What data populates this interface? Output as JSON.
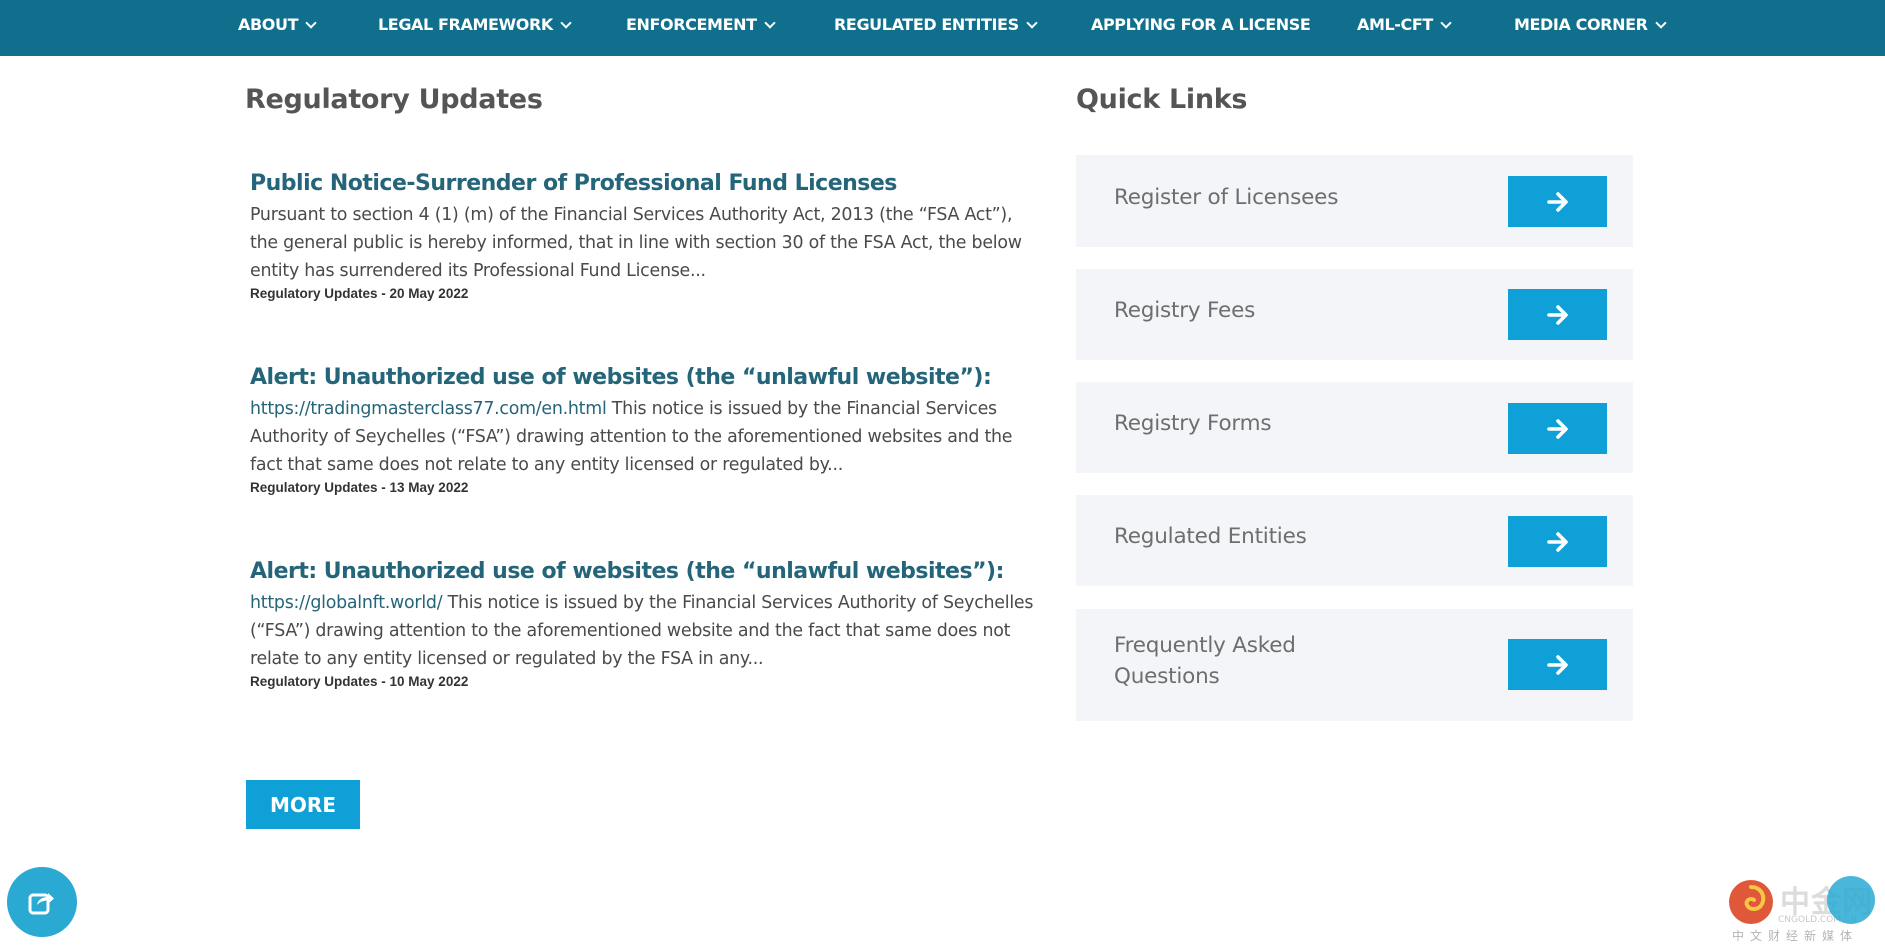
{
  "nav": {
    "items": [
      {
        "label": "ABOUT",
        "has_dropdown": true
      },
      {
        "label": "LEGAL FRAMEWORK",
        "has_dropdown": true
      },
      {
        "label": "ENFORCEMENT",
        "has_dropdown": true
      },
      {
        "label": "REGULATED ENTITIES",
        "has_dropdown": true
      },
      {
        "label": "APPLYING FOR A LICENSE",
        "has_dropdown": false
      },
      {
        "label": "AML-CFT",
        "has_dropdown": true
      },
      {
        "label": "MEDIA CORNER",
        "has_dropdown": true
      }
    ]
  },
  "updates": {
    "title": "Regulatory Updates",
    "items": [
      {
        "title": "Public Notice-Surrender of Professional Fund Licenses",
        "link_text": "",
        "body": "Pursuant to section 4 (1) (m) of the Financial Services Authority Act, 2013 (the “FSA Act”), the general public is hereby informed, that in line with section 30 of the FSA Act, the below entity has surrendered its Professional Fund License...",
        "category": "Regulatory Updates",
        "date": "20 May 2022"
      },
      {
        "title": "Alert: Unauthorized use of websites (the “unlawful website”):",
        "link_text": " https://tradingmasterclass77.com/en.html",
        "body": " This notice is issued by the Financial Services Authority of Seychelles (“FSA”) drawing attention to the aforementioned websites and the fact that same does not relate to any entity licensed or regulated by...",
        "category": "Regulatory Updates",
        "date": "13 May 2022"
      },
      {
        "title": "Alert: Unauthorized use of websites (the “unlawful websites”):",
        "link_text": "https://globalnft.world/",
        "body": " This notice is issued by the Financial Services Authority of Seychelles (“FSA”) drawing attention to the aforementioned website and the fact that same does not relate to any entity licensed or regulated by the FSA in any...",
        "category": "Regulatory Updates",
        "date": "10 May 2022"
      }
    ],
    "meta_separator": " - ",
    "more_label": "MORE"
  },
  "quick_links": {
    "title": "Quick Links",
    "items": [
      {
        "label": "Register of Licensees"
      },
      {
        "label": "Registry Fees"
      },
      {
        "label": "Registry Forms"
      },
      {
        "label": "Regulated Entities"
      },
      {
        "label": "Frequently Asked Questions"
      }
    ]
  },
  "watermark": {
    "text": "中金网",
    "sub": "CNGOLD.COM.CN",
    "sub2": "中文财经新媒体"
  },
  "colors": {
    "nav_bg": "#0f6f8c",
    "accent": "#0ea0d6",
    "link": "#24657a",
    "card_bg": "#f4f5f9"
  },
  "icons": {
    "nav_dropdown": "chevron-down-icon",
    "quick_link": "arrow-right-icon",
    "share": "share-icon"
  }
}
